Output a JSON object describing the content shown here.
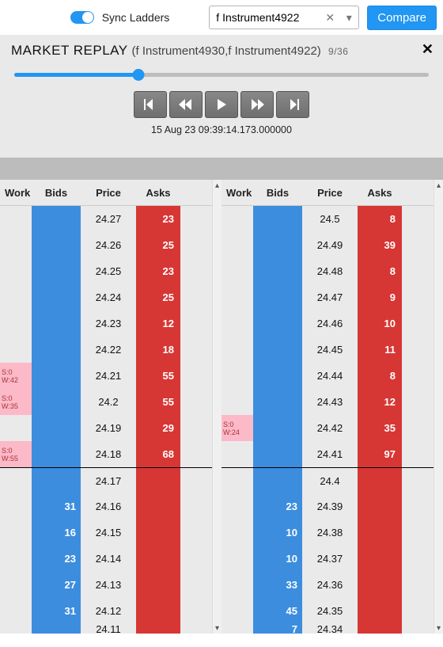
{
  "topbar": {
    "sync_label": "Sync Ladders",
    "instrument_value": "f Instrument4922",
    "compare_label": "Compare"
  },
  "replay": {
    "title_prefix": "MARKET REPLAY",
    "title_sub": "(f Instrument4930,f Instrument4922)",
    "index": "9/36",
    "progress_pct": 30,
    "timestamp": "15 Aug 23 09:39:14.173.000000"
  },
  "columns": {
    "work": "Work",
    "bids": "Bids",
    "price": "Price",
    "asks": "Asks"
  },
  "ladder_left": [
    {
      "work": null,
      "bid": null,
      "price": "24.27",
      "ask": "23",
      "bidcol": true,
      "askcol": true
    },
    {
      "work": null,
      "bid": null,
      "price": "24.26",
      "ask": "25",
      "bidcol": true,
      "askcol": true
    },
    {
      "work": null,
      "bid": null,
      "price": "24.25",
      "ask": "23",
      "bidcol": true,
      "askcol": true
    },
    {
      "work": null,
      "bid": null,
      "price": "24.24",
      "ask": "25",
      "bidcol": true,
      "askcol": true
    },
    {
      "work": null,
      "bid": null,
      "price": "24.23",
      "ask": "12",
      "bidcol": true,
      "askcol": true
    },
    {
      "work": null,
      "bid": null,
      "price": "24.22",
      "ask": "18",
      "bidcol": true,
      "askcol": true
    },
    {
      "work": {
        "s": "S:0",
        "w": "W:42"
      },
      "bid": null,
      "price": "24.21",
      "ask": "55",
      "bidcol": true,
      "askcol": true
    },
    {
      "work": {
        "s": "S:0",
        "w": "W:35"
      },
      "bid": null,
      "price": "24.2",
      "ask": "55",
      "bidcol": true,
      "askcol": true
    },
    {
      "work": null,
      "bid": null,
      "price": "24.19",
      "ask": "29",
      "bidcol": true,
      "askcol": true
    },
    {
      "work": {
        "s": "S:0",
        "w": "W:55"
      },
      "bid": null,
      "price": "24.18",
      "ask": "68",
      "bidcol": true,
      "askcol": true
    },
    {
      "work": null,
      "bid": null,
      "price": "24.17",
      "ask": null,
      "bidcol": true,
      "askcol": true,
      "mid": true
    },
    {
      "work": null,
      "bid": "31",
      "price": "24.16",
      "ask": null,
      "bidcol": true,
      "askcol": true
    },
    {
      "work": null,
      "bid": "16",
      "price": "24.15",
      "ask": null,
      "bidcol": true,
      "askcol": true
    },
    {
      "work": null,
      "bid": "23",
      "price": "24.14",
      "ask": null,
      "bidcol": true,
      "askcol": true
    },
    {
      "work": null,
      "bid": "27",
      "price": "24.13",
      "ask": null,
      "bidcol": true,
      "askcol": true
    },
    {
      "work": null,
      "bid": "31",
      "price": "24.12",
      "ask": null,
      "bidcol": true,
      "askcol": true
    },
    {
      "work": null,
      "bid": null,
      "price": "24.11",
      "ask": null,
      "bidcol": true,
      "askcol": true,
      "partial": true
    }
  ],
  "ladder_right": [
    {
      "work": null,
      "bid": null,
      "price": "24.5",
      "ask": "8",
      "bidcol": true,
      "askcol": true
    },
    {
      "work": null,
      "bid": null,
      "price": "24.49",
      "ask": "39",
      "bidcol": true,
      "askcol": true
    },
    {
      "work": null,
      "bid": null,
      "price": "24.48",
      "ask": "8",
      "bidcol": true,
      "askcol": true
    },
    {
      "work": null,
      "bid": null,
      "price": "24.47",
      "ask": "9",
      "bidcol": true,
      "askcol": true
    },
    {
      "work": null,
      "bid": null,
      "price": "24.46",
      "ask": "10",
      "bidcol": true,
      "askcol": true
    },
    {
      "work": null,
      "bid": null,
      "price": "24.45",
      "ask": "11",
      "bidcol": true,
      "askcol": true
    },
    {
      "work": null,
      "bid": null,
      "price": "24.44",
      "ask": "8",
      "bidcol": true,
      "askcol": true
    },
    {
      "work": null,
      "bid": null,
      "price": "24.43",
      "ask": "12",
      "bidcol": true,
      "askcol": true
    },
    {
      "work": {
        "s": "S:0",
        "w": "W:24"
      },
      "bid": null,
      "price": "24.42",
      "ask": "35",
      "bidcol": true,
      "askcol": true
    },
    {
      "work": null,
      "bid": null,
      "price": "24.41",
      "ask": "97",
      "bidcol": true,
      "askcol": true
    },
    {
      "work": null,
      "bid": null,
      "price": "24.4",
      "ask": null,
      "bidcol": true,
      "askcol": true,
      "mid": true
    },
    {
      "work": null,
      "bid": "23",
      "price": "24.39",
      "ask": null,
      "bidcol": true,
      "askcol": true
    },
    {
      "work": null,
      "bid": "10",
      "price": "24.38",
      "ask": null,
      "bidcol": true,
      "askcol": true
    },
    {
      "work": null,
      "bid": "10",
      "price": "24.37",
      "ask": null,
      "bidcol": true,
      "askcol": true
    },
    {
      "work": null,
      "bid": "33",
      "price": "24.36",
      "ask": null,
      "bidcol": true,
      "askcol": true
    },
    {
      "work": null,
      "bid": "45",
      "price": "24.35",
      "ask": null,
      "bidcol": true,
      "askcol": true
    },
    {
      "work": null,
      "bid": "7",
      "price": "24.34",
      "ask": null,
      "bidcol": true,
      "askcol": true,
      "partial": true
    }
  ]
}
